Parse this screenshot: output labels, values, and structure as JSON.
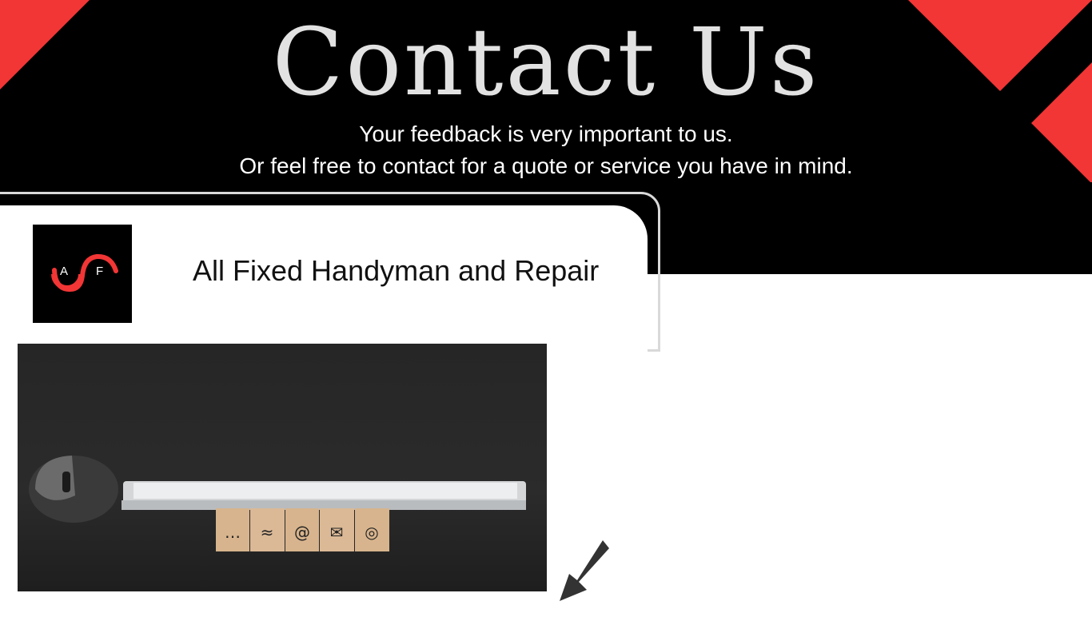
{
  "hero": {
    "title": "Contact Us",
    "line1": "Your feedback is very important to us.",
    "line2": "Or feel free to contact for a quote or service you have in mind."
  },
  "brand": {
    "logo_letters": [
      "A",
      "F"
    ],
    "name": "All Fixed Handyman and Repair"
  },
  "photo": {
    "subject": "keyboard-mouse-contact-blocks",
    "block_icons": [
      "chat-icon",
      "wifi-icon",
      "at-icon",
      "mail-icon",
      "globe-icon"
    ]
  },
  "colors": {
    "accent": "#f23535",
    "background_dark": "#000000",
    "title_gray": "#e2e2e2",
    "white": "#ffffff"
  },
  "icons": [
    "down-left-arrow-icon"
  ]
}
